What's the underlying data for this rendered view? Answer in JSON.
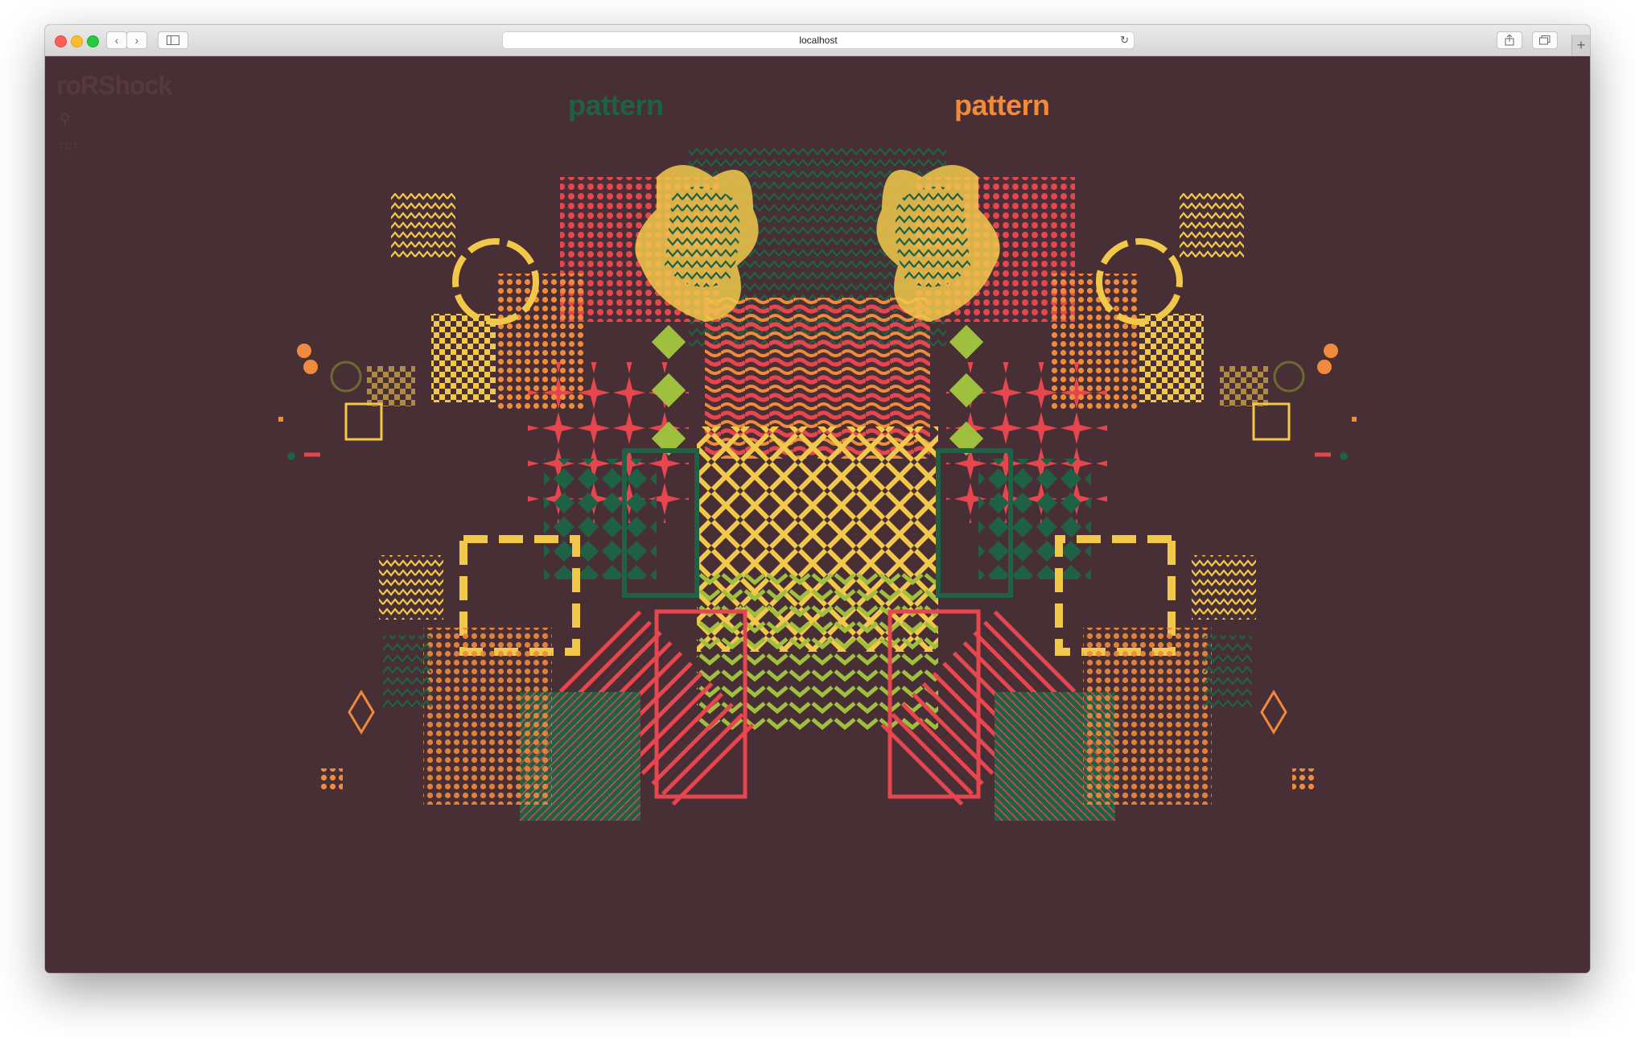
{
  "browser": {
    "address": "localhost",
    "buttons": {
      "back_icon": "chevron-left-icon",
      "forward_icon": "chevron-right-icon",
      "sidebar_icon": "sidebar-icon",
      "share_icon": "share-icon",
      "tabs_icon": "tabs-icon",
      "reload_icon": "reload-icon",
      "new_tab_icon": "plus-icon"
    }
  },
  "page": {
    "brand": "roRShock",
    "title_left": "pattern",
    "title_right": "pattern",
    "search_icon": "search-icon",
    "grid_icon": "grid-icon"
  },
  "colors": {
    "background": "#482e35",
    "red": "#e8464f",
    "orange": "#f08a3c",
    "yellow": "#f2c84b",
    "lime": "#9fbf3f",
    "green": "#1f6145",
    "brand": "#55393f"
  }
}
